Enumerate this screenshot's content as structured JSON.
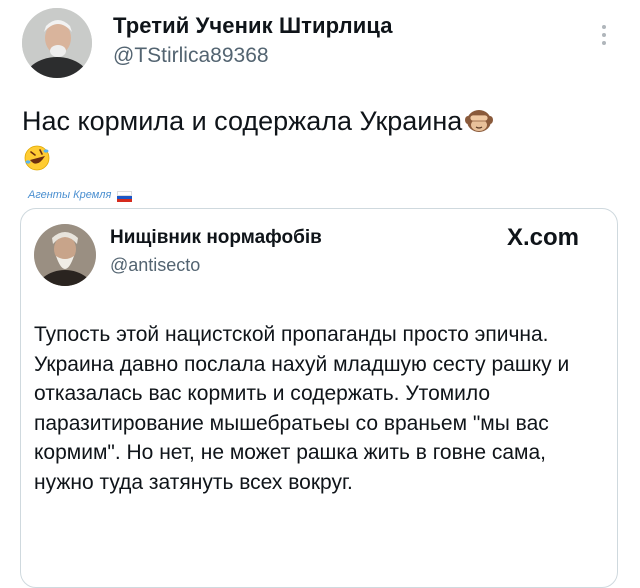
{
  "tweet": {
    "author_name": "Третий Ученик Штирлица",
    "author_handle": "@TStirlica89368",
    "text": "Нас кормила и содержала Украина",
    "emojis": [
      "see-no-evil-monkey",
      "rolling-on-floor-laughing"
    ]
  },
  "watermark": {
    "label": "Агенты Кремля",
    "flag_colors": [
      "#ffffff",
      "#1c57c7",
      "#d52b1e"
    ]
  },
  "quoted_tweet": {
    "author_name": "Нищівник нормафобів",
    "author_handle": "@antisecto",
    "source": "X.com",
    "text": "Тупость этой нацистской пропаганды просто эпична. Украина давно послала нахуй младшую сесту рашку и отказалась вас кормить и содержать. Утомило паразитирование мышебратьеы со враньем \"мы вас кормим\". Но нет, не может рашка жить в говне сама, нужно туда затянуть всех вокруг."
  },
  "colors": {
    "text": "#0f1419",
    "secondary_text": "#536471",
    "border": "#cfd9de",
    "watermark": "#4a8fd0"
  }
}
